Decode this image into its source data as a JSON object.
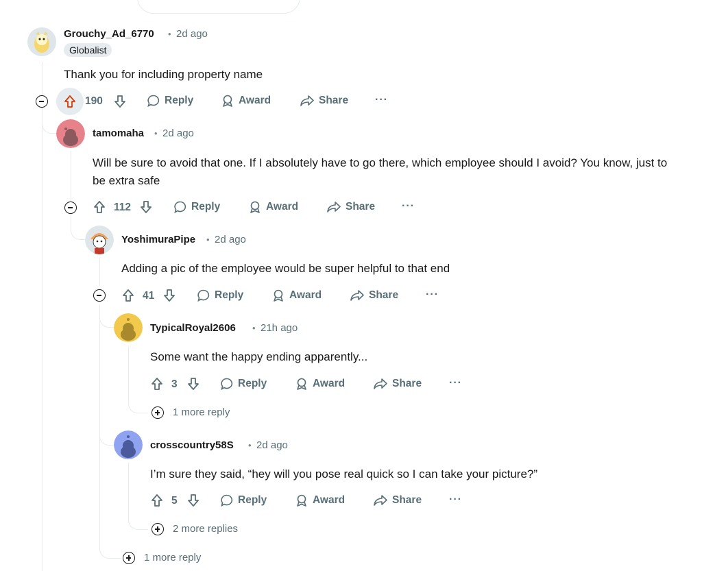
{
  "comments": [
    {
      "username": "Grouchy_Ad_6770",
      "time": "2d ago",
      "flair": "Globalist",
      "body": "Thank you for including property name",
      "votes": "190",
      "upvoted": true,
      "avatar_color": "#f5d76e"
    },
    {
      "username": "tamomaha",
      "time": "2d ago",
      "body": "Will be sure to avoid that one. If I absolutely have to go there, which employee should I avoid? You know, just to be extra safe",
      "votes": "112",
      "avatar_color": "#e8828a"
    },
    {
      "username": "YoshimuraPipe",
      "time": "2d ago",
      "body": "Adding a pic of the employee would be super helpful to that end",
      "votes": "41",
      "avatar_color": "#f3a25c"
    },
    {
      "username": "TypicalRoyal2606",
      "time": "21h ago",
      "body": "Some want the happy ending apparently...",
      "votes": "3",
      "avatar_color": "#f2c94c"
    },
    {
      "username": "crosscountry58S",
      "time": "2d ago",
      "body": "I’m sure they said, “hey will you pose real quick so I can take your picture?”",
      "votes": "5",
      "avatar_color": "#8fa3f0"
    }
  ],
  "actions": {
    "reply": "Reply",
    "award": "Award",
    "share": "Share",
    "more": "···"
  },
  "more_replies": {
    "typicalroyal": "1 more reply",
    "crosscountry": "2 more replies",
    "yoshimura": "1 more reply"
  },
  "colors": {
    "upvote_active": "#d93a00",
    "meta": "#576f76",
    "thread_line": "#e5ebee"
  },
  "icons": [
    "upvote-icon",
    "downvote-icon",
    "reply-icon",
    "award-icon",
    "share-icon",
    "more-icon",
    "collapse-icon",
    "expand-icon"
  ],
  "separator": "•"
}
